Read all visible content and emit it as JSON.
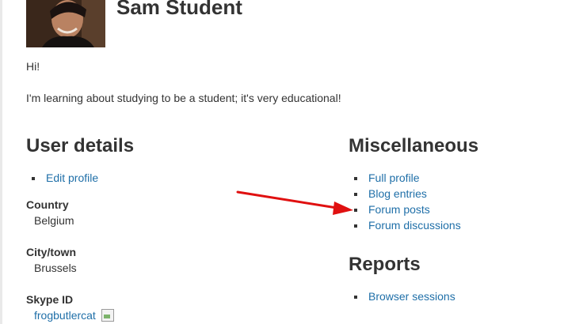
{
  "profile": {
    "name": "Sam Student",
    "description_lines": [
      "Hi!",
      "I'm learning about studying to be a student; it's very educational!"
    ]
  },
  "user_details": {
    "title": "User details",
    "edit_profile": "Edit profile",
    "fields": [
      {
        "label": "Country",
        "value": "Belgium"
      },
      {
        "label": "City/town",
        "value": "Brussels"
      },
      {
        "label": "Skype ID",
        "value": "frogbutlercat"
      }
    ]
  },
  "miscellaneous": {
    "title": "Miscellaneous",
    "links": [
      "Full profile",
      "Blog entries",
      "Forum posts",
      "Forum discussions"
    ]
  },
  "reports": {
    "title": "Reports",
    "links": [
      "Browser sessions"
    ]
  },
  "colors": {
    "link": "#1f6fa8",
    "text": "#333333",
    "annotation_arrow": "#e01010"
  },
  "icons": {
    "skype_status": "broken-image-icon"
  }
}
